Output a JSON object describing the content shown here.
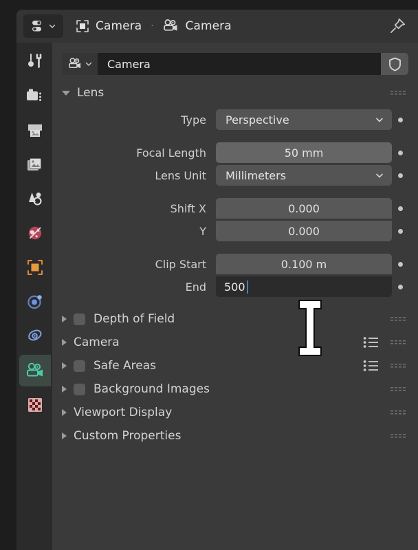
{
  "window": {
    "editor_type_icon": "properties-editor-icon",
    "pin_icon": "pin-icon"
  },
  "breadcrumb": {
    "items": [
      {
        "icon": "object-data-icon",
        "label": "Camera"
      },
      {
        "icon": "camera-data-icon",
        "label": "Camera"
      }
    ],
    "separator": "·"
  },
  "tabs": [
    {
      "name": "tool",
      "icon": "tool-icon",
      "selected": false
    },
    {
      "name": "render",
      "icon": "render-icon",
      "selected": false
    },
    {
      "name": "output",
      "icon": "output-printer-icon",
      "selected": false
    },
    {
      "name": "view-layer",
      "icon": "view-layer-icon",
      "selected": false
    },
    {
      "name": "scene",
      "icon": "scene-icon",
      "selected": false
    },
    {
      "name": "world",
      "icon": "world-globe-icon",
      "selected": false
    },
    {
      "name": "object",
      "icon": "object-square-icon",
      "selected": false
    },
    {
      "name": "modifiers",
      "icon": "physics-orbit-icon",
      "selected": false
    },
    {
      "name": "object-constraints",
      "icon": "constraint-icon",
      "selected": false
    },
    {
      "name": "object-data-camera",
      "icon": "camera-data-icon",
      "selected": true
    },
    {
      "name": "texture",
      "icon": "texture-checker-icon",
      "selected": false
    }
  ],
  "id_block": {
    "datablock_icon": "camera-data-icon",
    "name": "Camera",
    "fake_user_icon": "shield-icon"
  },
  "lens_panel": {
    "title": "Lens",
    "expanded": true,
    "properties": [
      {
        "label": "Type",
        "value": "Perspective",
        "widget": "dropdown"
      },
      {
        "label": "Focal Length",
        "value": "50 mm",
        "widget": "slider"
      },
      {
        "label": "Lens Unit",
        "value": "Millimeters",
        "widget": "dropdown"
      },
      {
        "label": "Shift X",
        "value": "0.000",
        "widget": "number"
      },
      {
        "label": "Y",
        "value": "0.000",
        "widget": "number"
      },
      {
        "label": "Clip Start",
        "value": "0.100 m",
        "widget": "number"
      },
      {
        "label": "End",
        "value": "500",
        "widget": "text-edit-active"
      }
    ]
  },
  "panels": [
    {
      "title": "Depth of Field",
      "expanded": false,
      "checkbox": true,
      "has_presets": false
    },
    {
      "title": "Camera",
      "expanded": false,
      "checkbox": false,
      "has_presets": true
    },
    {
      "title": "Safe Areas",
      "expanded": false,
      "checkbox": true,
      "has_presets": true
    },
    {
      "title": "Background Images",
      "expanded": false,
      "checkbox": true,
      "has_presets": false
    },
    {
      "title": "Viewport Display",
      "expanded": false,
      "checkbox": false,
      "has_presets": false
    },
    {
      "title": "Custom Properties",
      "expanded": false,
      "checkbox": false,
      "has_presets": false
    }
  ],
  "colors": {
    "window_bg": "#1d1d1d",
    "header_bg": "#343434",
    "panel_bg": "#3a3a3a",
    "tabcol_bg": "#2b2b2b",
    "field_bg": "#545454",
    "slider_bg": "#656565",
    "edit_bg": "#2b2b2b",
    "text": "#e2e2e2",
    "caret": "#4a7ebb",
    "camera_tab_accent": "#4ec9a8"
  }
}
